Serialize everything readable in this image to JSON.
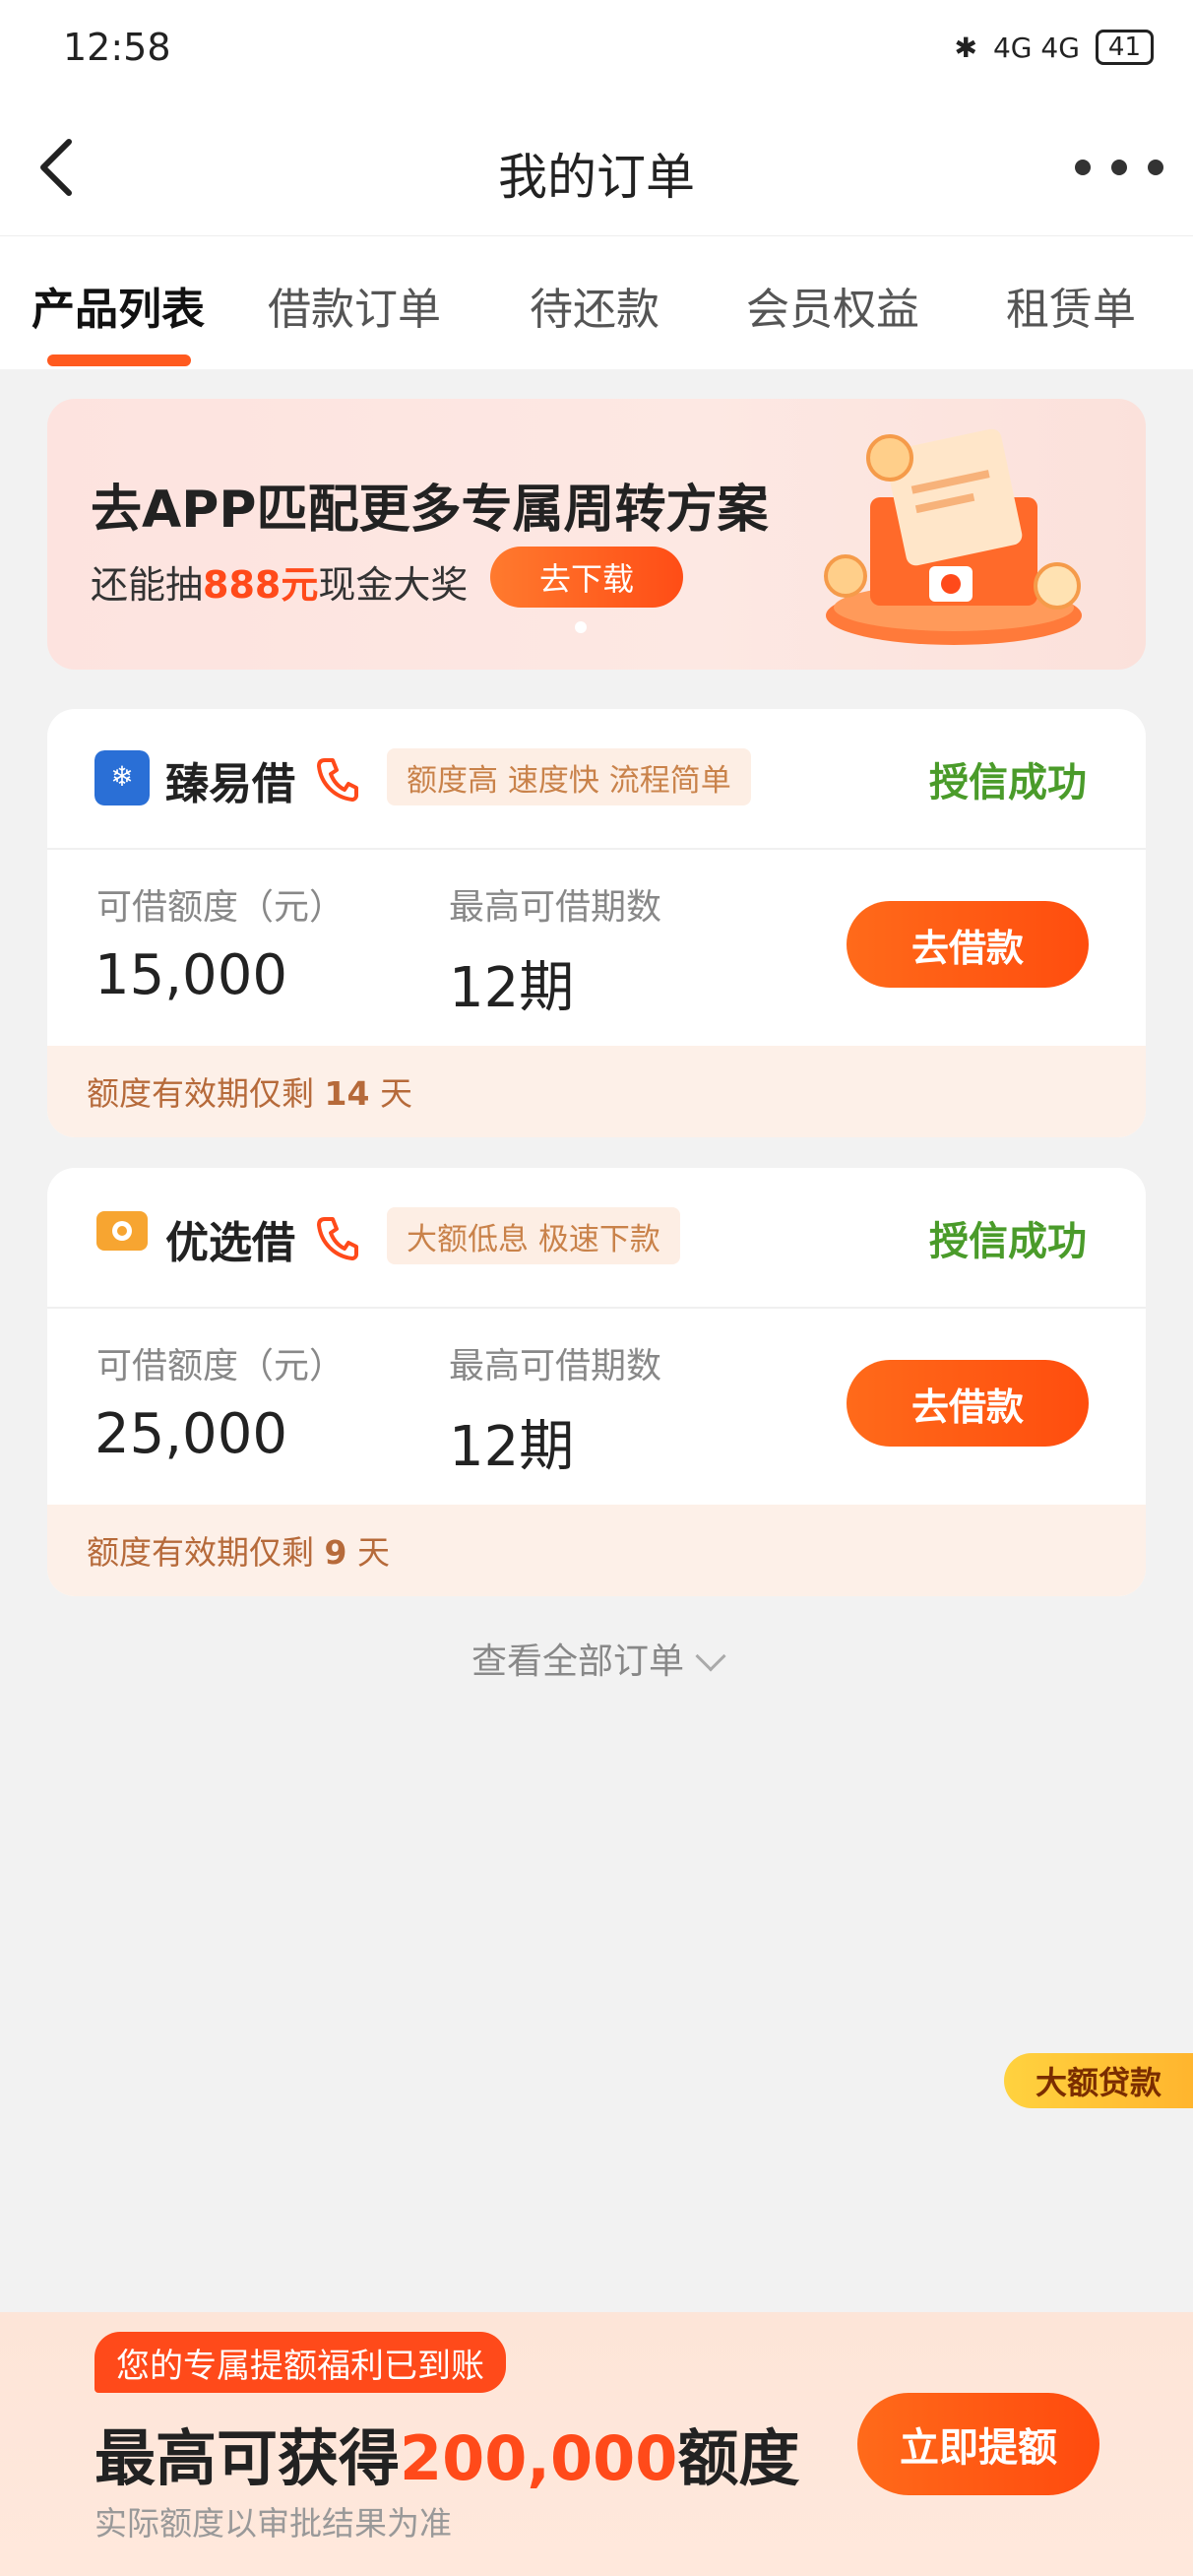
{
  "status_bar": {
    "time": "12:58",
    "network": "4G 4G",
    "battery": "41"
  },
  "navbar": {
    "title": "我的订单"
  },
  "tabs": [
    {
      "label": "产品列表",
      "active": true
    },
    {
      "label": "借款订单",
      "active": false
    },
    {
      "label": "待还款",
      "active": false
    },
    {
      "label": "会员权益",
      "active": false
    },
    {
      "label": "租赁单",
      "active": false
    }
  ],
  "banner": {
    "title": "去APP匹配更多专属周转方案",
    "sub_prefix": "还能抽",
    "sub_highlight": "888元",
    "sub_suffix": "现金大奖",
    "button": "去下载"
  },
  "cards": [
    {
      "name": "臻易借",
      "tag": "额度高 速度快 流程简单",
      "status": "授信成功",
      "limit_label": "可借额度（元）",
      "limit_value": "15,000",
      "periods_label": "最高可借期数",
      "periods_value": "12期",
      "button": "去借款",
      "expiry_prefix": "额度有效期仅剩",
      "expiry_days": "14",
      "expiry_suffix": "天",
      "logo_color": "#2a6fd6"
    },
    {
      "name": "优选借",
      "tag": "大额低息 极速下款",
      "status": "授信成功",
      "limit_label": "可借额度（元）",
      "limit_value": "25,000",
      "periods_label": "最高可借期数",
      "periods_value": "12期",
      "button": "去借款",
      "expiry_prefix": "额度有效期仅剩",
      "expiry_days": "9",
      "expiry_suffix": "天",
      "logo_color": "#f7a531"
    }
  ],
  "view_all": "查看全部订单",
  "float_tag": "大额贷款",
  "bottom_bar": {
    "badge": "您的专属提额福利已到账",
    "main_prefix": "最高可获得",
    "main_amount": "200,000",
    "main_suffix": "额度",
    "note": "实际额度以审批结果为准",
    "button": "立即提额"
  },
  "colors": {
    "accent": "#ff5a1f",
    "success": "#4a9b2a"
  }
}
